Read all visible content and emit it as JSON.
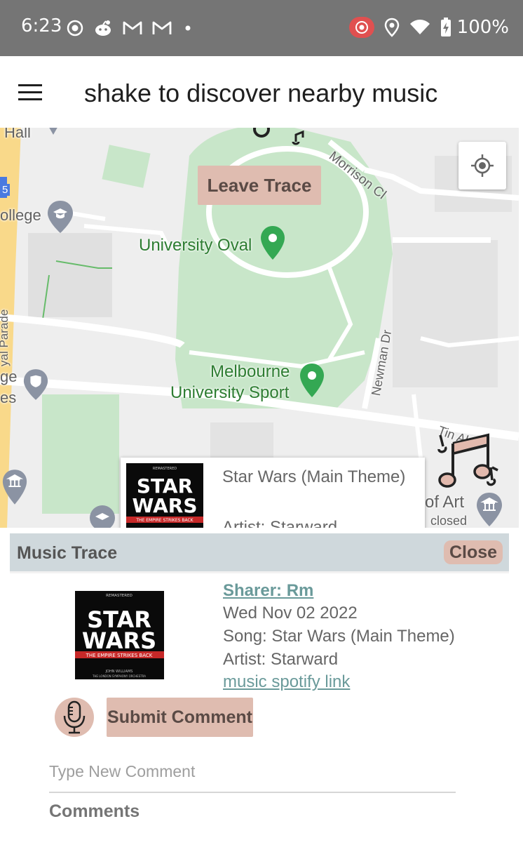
{
  "status_bar": {
    "time": "6:23",
    "battery": "100%",
    "left_icons": [
      "screen-record-icon",
      "reddit-icon",
      "gmail-icon",
      "gmail-icon",
      "dot-icon"
    ],
    "right_icons": [
      "cast-recording-icon",
      "location-icon",
      "wifi-icon",
      "battery-charging-icon"
    ]
  },
  "app_bar": {
    "menu_icon": "hamburger-menu-icon",
    "title": "shake to discover nearby music"
  },
  "map": {
    "leave_trace_label": "Leave Trace",
    "labels": {
      "university_oval": "University Oval",
      "melbourne_line1": "Melbourne",
      "melbourne_line2": "University Sport",
      "hall": "Hall",
      "college": "ollege",
      "ge": "ge",
      "es": "es",
      "parade": "yal Parade",
      "morrison": "Morrison Cl",
      "newman": "Newman Dr",
      "tin": "Tin Al",
      "of_art": "of Art",
      "closed": "closed",
      "route": "5"
    },
    "info_window": {
      "cover_text_top": "REMASTERED",
      "cover_text_star": "STAR",
      "cover_text_wars": "WARS",
      "cover_text_sub": "THE EMPIRE STRIKES BACK",
      "song": "Star Wars (Main Theme)",
      "artist": "Artist: Starward"
    }
  },
  "panel": {
    "title": "Music Trace",
    "close_label": "Close",
    "sharer": "Sharer: Rm",
    "date": "Wed Nov 02 2022",
    "song": "Song: Star Wars (Main Theme)",
    "artist": "Artist: Starward",
    "link_text": "music spotify link",
    "cover_text_top": "REMASTERED",
    "cover_text_star": "STAR",
    "cover_text_wars": "WARS",
    "cover_text_sub": "THE EMPIRE STRIKES BACK",
    "cover_text_credits": "JOHN WILLIAMS",
    "cover_text_credits2": "THE LONDON SYMPHONY ORCHESTRA",
    "submit_label": "Submit Comment",
    "comment_placeholder": "Type New Comment",
    "comments_title": "Comments"
  },
  "colors": {
    "status_bar": "#757575",
    "button_bg": "#dfbcb0",
    "panel_header": "#cfd8dc",
    "link": "#6a9a9a",
    "park_green": "#c8e6c9"
  }
}
